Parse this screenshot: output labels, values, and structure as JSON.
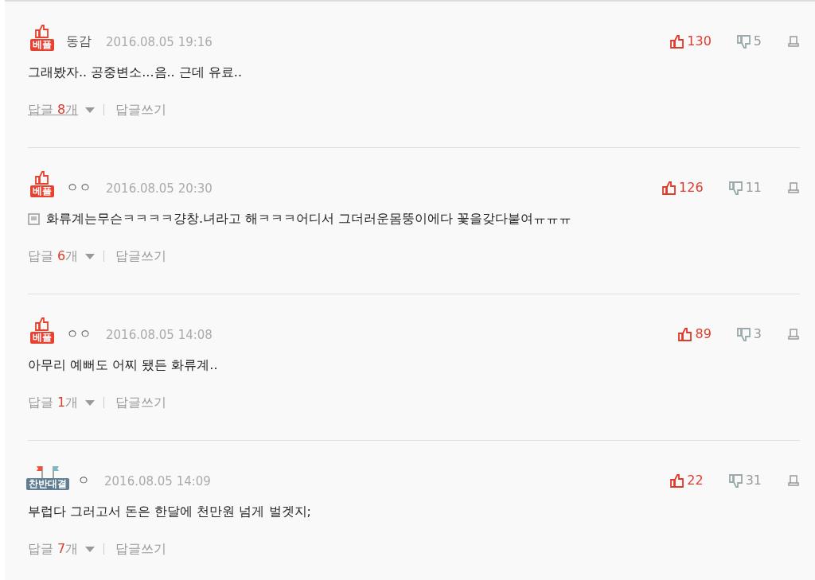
{
  "comments": [
    {
      "badge": {
        "kind": "best",
        "label": "베플"
      },
      "author": "동감",
      "date": "2016.08.05 19:16",
      "likes": "130",
      "dislikes": "5",
      "attachment_icon": false,
      "text": "그래봤자.. 공중변소...음.. 근데 유료..",
      "replies": {
        "label": "답글",
        "count": "8",
        "unit": "개",
        "underlined": true
      },
      "write_label": "답글쓰기"
    },
    {
      "badge": {
        "kind": "best",
        "label": "베플"
      },
      "author": "ㅇㅇ",
      "date": "2016.08.05 20:30",
      "likes": "126",
      "dislikes": "11",
      "attachment_icon": true,
      "text": "화류계는무슨ㅋㅋㅋㅋ걍창.녀라고 해ㅋㅋㅋ어디서 그더러운몸뚱이에다 꽃을갖다붙여ㅠㅠㅠ",
      "replies": {
        "label": "답글",
        "count": "6",
        "unit": "개",
        "underlined": false
      },
      "write_label": "답글쓰기"
    },
    {
      "badge": {
        "kind": "best",
        "label": "베플"
      },
      "author": "ㅇㅇ",
      "date": "2016.08.05 14:08",
      "likes": "89",
      "dislikes": "3",
      "attachment_icon": false,
      "text": "아무리 예뻐도 어찌 됐든 화류계..",
      "replies": {
        "label": "답글",
        "count": "1",
        "unit": "개",
        "underlined": false
      },
      "write_label": "답글쓰기"
    },
    {
      "badge": {
        "kind": "contest",
        "label": "찬반대결"
      },
      "author": "ㅇ",
      "date": "2016.08.05 14:09",
      "likes": "22",
      "dislikes": "31",
      "attachment_icon": false,
      "text": "부럽다 그러고서 돈은 한달에 천만원 넘게 벌겟지;",
      "replies": {
        "label": "답글",
        "count": "7",
        "unit": "개",
        "underlined": false
      },
      "write_label": "답글쓰기"
    }
  ]
}
